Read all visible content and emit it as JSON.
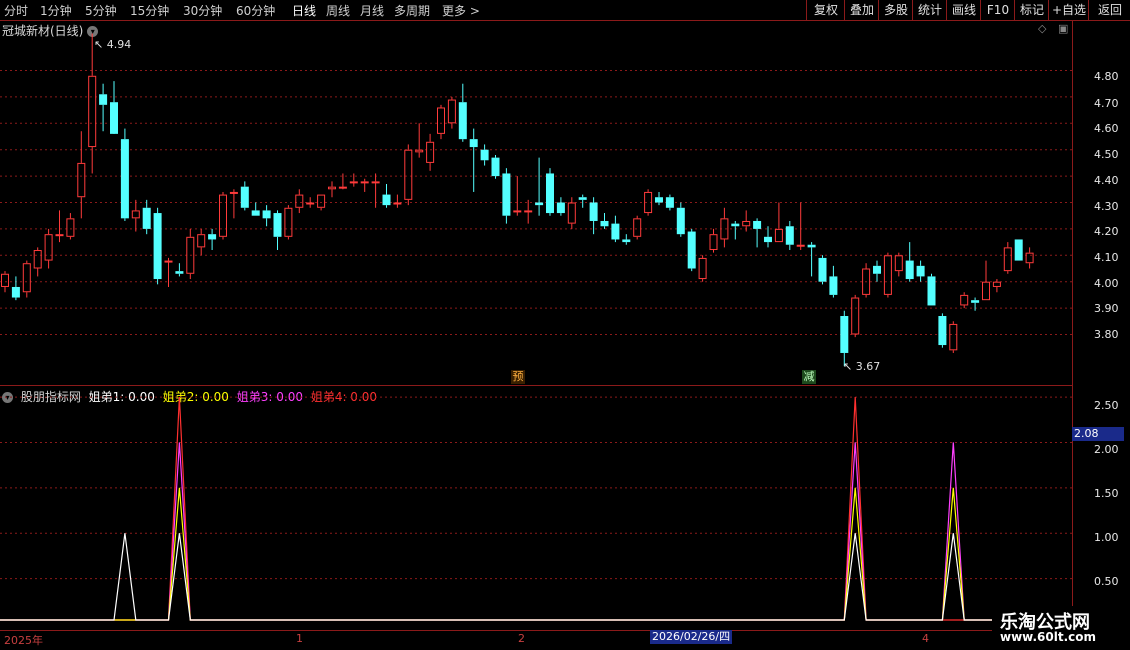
{
  "toolbar": {
    "timeframes": [
      "分时",
      "1分钟",
      "5分钟",
      "15分钟",
      "30分钟",
      "60分钟",
      "日线",
      "周线",
      "月线",
      "多周期",
      "更多 >"
    ],
    "active_timeframe": "日线",
    "buttons": [
      "复权",
      "叠加",
      "多股",
      "统计",
      "画线",
      "F10",
      "标记",
      "+自选",
      "返回"
    ]
  },
  "stock_title": "冠城新材(日线)",
  "price_axis": [
    "4.80",
    "4.70",
    "4.60",
    "4.50",
    "4.40",
    "4.30",
    "4.20",
    "4.10",
    "4.00",
    "3.90",
    "3.80"
  ],
  "high_label": "4.94",
  "low_label": "3.67",
  "markers": {
    "yu": "预",
    "jian": "减"
  },
  "indicator": {
    "name": "股朋指标网",
    "series": [
      {
        "label": "姐弟1: 0.00",
        "color": "#ffffff"
      },
      {
        "label": "姐弟2: 0.00",
        "color": "#ffff00"
      },
      {
        "label": "姐弟3: 0.00",
        "color": "#ff40ff"
      },
      {
        "label": "姐弟4: 0.00",
        "color": "#ff3030"
      }
    ],
    "axis": [
      "2.50",
      "2.00",
      "1.50",
      "1.00",
      "0.50"
    ],
    "current_value": "2.08"
  },
  "date_axis": {
    "labels": [
      "2025年",
      "1",
      "2",
      "4"
    ],
    "current_date": "2026/02/26/四"
  },
  "watermark": {
    "line1": "乐淘公式网",
    "line2": "www.60lt.com"
  },
  "colors": {
    "up": "#ff3b3b",
    "down": "#54ffff",
    "grid": "#8b1a1a"
  },
  "chart_data": {
    "type": "candlestick",
    "title": "冠城新材(日线)",
    "price_range": [
      3.62,
      4.98
    ],
    "candles": [
      {
        "o": 3.98,
        "h": 4.04,
        "l": 3.96,
        "c": 4.03
      },
      {
        "o": 3.98,
        "h": 4.02,
        "l": 3.93,
        "c": 3.94
      },
      {
        "o": 3.96,
        "h": 4.08,
        "l": 3.94,
        "c": 4.07
      },
      {
        "o": 4.05,
        "h": 4.13,
        "l": 4.02,
        "c": 4.12
      },
      {
        "o": 4.08,
        "h": 4.2,
        "l": 4.05,
        "c": 4.18
      },
      {
        "o": 4.18,
        "h": 4.27,
        "l": 4.15,
        "c": 4.18
      },
      {
        "o": 4.17,
        "h": 4.26,
        "l": 4.16,
        "c": 4.24
      },
      {
        "o": 4.32,
        "h": 4.57,
        "l": 4.24,
        "c": 4.45
      },
      {
        "o": 4.51,
        "h": 4.94,
        "l": 4.41,
        "c": 4.78
      },
      {
        "o": 4.71,
        "h": 4.75,
        "l": 4.57,
        "c": 4.67
      },
      {
        "o": 4.68,
        "h": 4.76,
        "l": 4.62,
        "c": 4.56
      },
      {
        "o": 4.54,
        "h": 4.58,
        "l": 4.23,
        "c": 4.24
      },
      {
        "o": 4.24,
        "h": 4.31,
        "l": 4.19,
        "c": 4.27
      },
      {
        "o": 4.28,
        "h": 4.31,
        "l": 4.18,
        "c": 4.2
      },
      {
        "o": 4.26,
        "h": 4.28,
        "l": 3.99,
        "c": 4.01
      },
      {
        "o": 4.08,
        "h": 4.09,
        "l": 3.98,
        "c": 4.08
      },
      {
        "o": 4.04,
        "h": 4.07,
        "l": 4.02,
        "c": 4.03
      },
      {
        "o": 4.03,
        "h": 4.2,
        "l": 4.01,
        "c": 4.17
      },
      {
        "o": 4.13,
        "h": 4.2,
        "l": 4.1,
        "c": 4.18
      },
      {
        "o": 4.18,
        "h": 4.2,
        "l": 4.12,
        "c": 4.16
      },
      {
        "o": 4.17,
        "h": 4.34,
        "l": 4.16,
        "c": 4.33
      },
      {
        "o": 4.34,
        "h": 4.35,
        "l": 4.24,
        "c": 4.34
      },
      {
        "o": 4.36,
        "h": 4.38,
        "l": 4.27,
        "c": 4.28
      },
      {
        "o": 4.27,
        "h": 4.3,
        "l": 4.25,
        "c": 4.25
      },
      {
        "o": 4.27,
        "h": 4.29,
        "l": 4.21,
        "c": 4.24
      },
      {
        "o": 4.26,
        "h": 4.27,
        "l": 4.12,
        "c": 4.17
      },
      {
        "o": 4.17,
        "h": 4.29,
        "l": 4.16,
        "c": 4.28
      },
      {
        "o": 4.28,
        "h": 4.35,
        "l": 4.26,
        "c": 4.33
      },
      {
        "o": 4.3,
        "h": 4.32,
        "l": 4.28,
        "c": 4.3
      },
      {
        "o": 4.28,
        "h": 4.33,
        "l": 4.27,
        "c": 4.33
      },
      {
        "o": 4.35,
        "h": 4.38,
        "l": 4.32,
        "c": 4.36
      },
      {
        "o": 4.36,
        "h": 4.41,
        "l": 4.35,
        "c": 4.36
      },
      {
        "o": 4.38,
        "h": 4.41,
        "l": 4.36,
        "c": 4.38
      },
      {
        "o": 4.38,
        "h": 4.39,
        "l": 4.34,
        "c": 4.38
      },
      {
        "o": 4.38,
        "h": 4.41,
        "l": 4.28,
        "c": 4.38
      },
      {
        "o": 4.33,
        "h": 4.37,
        "l": 4.28,
        "c": 4.29
      },
      {
        "o": 4.3,
        "h": 4.33,
        "l": 4.28,
        "c": 4.3
      },
      {
        "o": 4.31,
        "h": 4.52,
        "l": 4.29,
        "c": 4.5
      },
      {
        "o": 4.49,
        "h": 4.6,
        "l": 4.47,
        "c": 4.5
      },
      {
        "o": 4.45,
        "h": 4.56,
        "l": 4.42,
        "c": 4.53
      },
      {
        "o": 4.56,
        "h": 4.67,
        "l": 4.54,
        "c": 4.66
      },
      {
        "o": 4.6,
        "h": 4.7,
        "l": 4.58,
        "c": 4.69
      },
      {
        "o": 4.68,
        "h": 4.75,
        "l": 4.53,
        "c": 4.54
      },
      {
        "o": 4.54,
        "h": 4.58,
        "l": 4.34,
        "c": 4.51
      },
      {
        "o": 4.5,
        "h": 4.52,
        "l": 4.44,
        "c": 4.46
      },
      {
        "o": 4.47,
        "h": 4.48,
        "l": 4.39,
        "c": 4.4
      },
      {
        "o": 4.41,
        "h": 4.43,
        "l": 4.22,
        "c": 4.25
      },
      {
        "o": 4.27,
        "h": 4.4,
        "l": 4.25,
        "c": 4.27
      },
      {
        "o": 4.27,
        "h": 4.31,
        "l": 4.22,
        "c": 4.27
      },
      {
        "o": 4.3,
        "h": 4.47,
        "l": 4.25,
        "c": 4.29
      },
      {
        "o": 4.41,
        "h": 4.43,
        "l": 4.25,
        "c": 4.26
      },
      {
        "o": 4.3,
        "h": 4.32,
        "l": 4.25,
        "c": 4.26
      },
      {
        "o": 4.22,
        "h": 4.32,
        "l": 4.2,
        "c": 4.3
      },
      {
        "o": 4.32,
        "h": 4.33,
        "l": 4.28,
        "c": 4.31
      },
      {
        "o": 4.3,
        "h": 4.32,
        "l": 4.18,
        "c": 4.23
      },
      {
        "o": 4.23,
        "h": 4.26,
        "l": 4.2,
        "c": 4.21
      },
      {
        "o": 4.22,
        "h": 4.25,
        "l": 4.15,
        "c": 4.16
      },
      {
        "o": 4.16,
        "h": 4.18,
        "l": 4.14,
        "c": 4.15
      },
      {
        "o": 4.17,
        "h": 4.25,
        "l": 4.16,
        "c": 4.24
      },
      {
        "o": 4.26,
        "h": 4.35,
        "l": 4.25,
        "c": 4.34
      },
      {
        "o": 4.32,
        "h": 4.34,
        "l": 4.29,
        "c": 4.3
      },
      {
        "o": 4.32,
        "h": 4.33,
        "l": 4.27,
        "c": 4.28
      },
      {
        "o": 4.28,
        "h": 4.3,
        "l": 4.17,
        "c": 4.18
      },
      {
        "o": 4.19,
        "h": 4.2,
        "l": 4.04,
        "c": 4.05
      },
      {
        "o": 4.01,
        "h": 4.1,
        "l": 4.0,
        "c": 4.09
      },
      {
        "o": 4.12,
        "h": 4.2,
        "l": 4.11,
        "c": 4.18
      },
      {
        "o": 4.16,
        "h": 4.28,
        "l": 4.13,
        "c": 4.24
      },
      {
        "o": 4.22,
        "h": 4.23,
        "l": 4.16,
        "c": 4.21
      },
      {
        "o": 4.21,
        "h": 4.27,
        "l": 4.19,
        "c": 4.23
      },
      {
        "o": 4.23,
        "h": 4.24,
        "l": 4.13,
        "c": 4.2
      },
      {
        "o": 4.17,
        "h": 4.21,
        "l": 4.13,
        "c": 4.15
      },
      {
        "o": 4.15,
        "h": 4.3,
        "l": 4.15,
        "c": 4.2
      },
      {
        "o": 4.21,
        "h": 4.23,
        "l": 4.12,
        "c": 4.14
      },
      {
        "o": 4.14,
        "h": 4.3,
        "l": 4.12,
        "c": 4.14
      },
      {
        "o": 4.14,
        "h": 4.15,
        "l": 4.02,
        "c": 4.13
      },
      {
        "o": 4.09,
        "h": 4.1,
        "l": 3.99,
        "c": 4.0
      },
      {
        "o": 4.02,
        "h": 4.06,
        "l": 3.94,
        "c": 3.95
      },
      {
        "o": 3.87,
        "h": 3.89,
        "l": 3.68,
        "c": 3.73
      },
      {
        "o": 3.8,
        "h": 3.95,
        "l": 3.79,
        "c": 3.94
      },
      {
        "o": 3.95,
        "h": 4.07,
        "l": 3.94,
        "c": 4.05
      },
      {
        "o": 4.06,
        "h": 4.08,
        "l": 4.0,
        "c": 4.03
      },
      {
        "o": 3.95,
        "h": 4.11,
        "l": 3.94,
        "c": 4.1
      },
      {
        "o": 4.04,
        "h": 4.11,
        "l": 4.02,
        "c": 4.1
      },
      {
        "o": 4.08,
        "h": 4.15,
        "l": 4.0,
        "c": 4.01
      },
      {
        "o": 4.06,
        "h": 4.08,
        "l": 4.0,
        "c": 4.02
      },
      {
        "o": 4.02,
        "h": 4.03,
        "l": 3.91,
        "c": 3.91
      },
      {
        "o": 3.87,
        "h": 3.88,
        "l": 3.75,
        "c": 3.76
      },
      {
        "o": 3.74,
        "h": 3.85,
        "l": 3.73,
        "c": 3.84
      },
      {
        "o": 3.91,
        "h": 3.96,
        "l": 3.9,
        "c": 3.95
      },
      {
        "o": 3.93,
        "h": 3.94,
        "l": 3.89,
        "c": 3.92
      },
      {
        "o": 3.93,
        "h": 4.08,
        "l": 3.93,
        "c": 4.0
      },
      {
        "o": 3.98,
        "h": 4.01,
        "l": 3.96,
        "c": 4.0
      },
      {
        "o": 4.04,
        "h": 4.15,
        "l": 4.03,
        "c": 4.13
      },
      {
        "o": 4.16,
        "h": 4.16,
        "l": 4.08,
        "c": 4.08
      },
      {
        "o": 4.07,
        "h": 4.13,
        "l": 4.05,
        "c": 4.11
      }
    ],
    "indicator_range": [
      0,
      2.6
    ],
    "indicator_series": [
      {
        "name": "姐弟1",
        "color": "#ffffff",
        "peaks": [
          {
            "i": 11,
            "v": 1.0
          },
          {
            "i": 16,
            "v": 1.0
          },
          {
            "i": 78,
            "v": 1.0
          },
          {
            "i": 87,
            "v": 1.0
          }
        ]
      },
      {
        "name": "姐弟2",
        "color": "#ffff00",
        "peaks": [
          {
            "i": 16,
            "v": 1.5
          },
          {
            "i": 78,
            "v": 1.5
          },
          {
            "i": 87,
            "v": 1.5
          }
        ]
      },
      {
        "name": "姐弟3",
        "color": "#ff40ff",
        "peaks": [
          {
            "i": 16,
            "v": 2.0
          },
          {
            "i": 78,
            "v": 2.0
          },
          {
            "i": 87,
            "v": 2.0
          }
        ]
      },
      {
        "name": "姐弟4",
        "color": "#ff3030",
        "peaks": [
          {
            "i": 16,
            "v": 2.5
          },
          {
            "i": 78,
            "v": 2.5
          }
        ]
      }
    ]
  }
}
